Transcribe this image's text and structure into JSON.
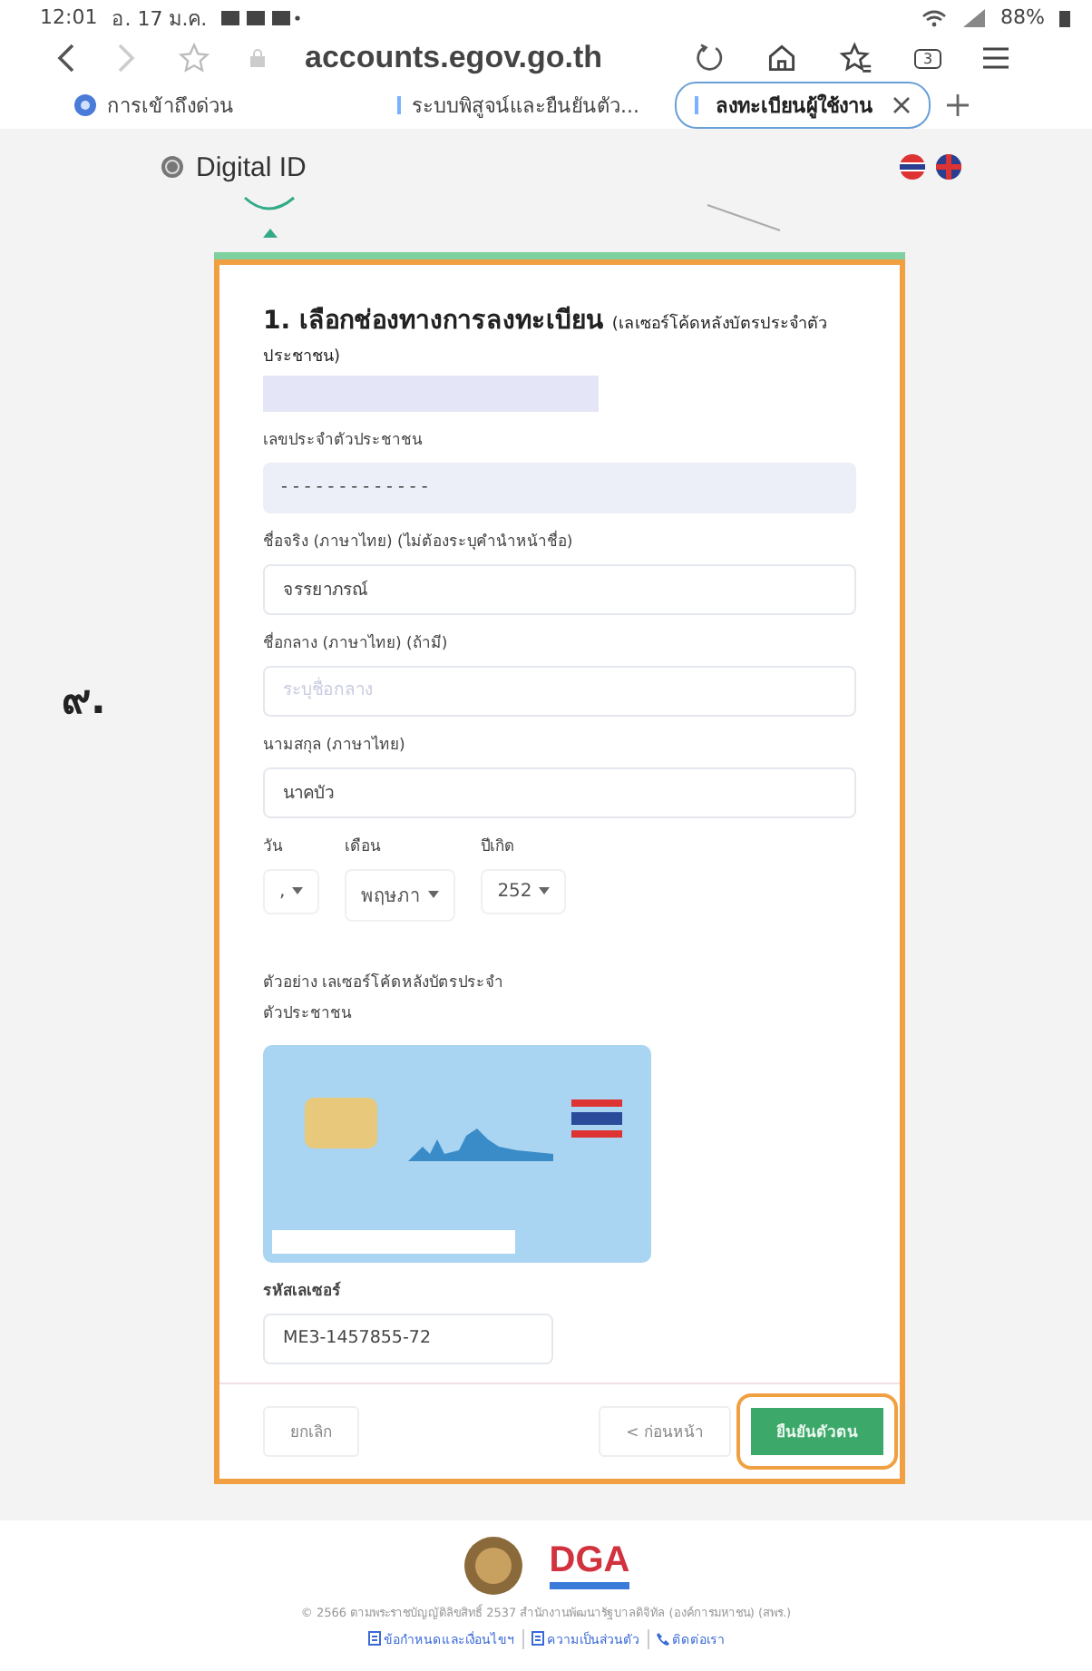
{
  "status_bar": {
    "time": "12:01",
    "date": "อ. 17 ม.ค.",
    "battery": "88%"
  },
  "browser": {
    "url": "accounts.egov.go.th",
    "tab_count": "3"
  },
  "tabs": [
    {
      "label": "การเข้าถึงด่วน",
      "selected": false,
      "kind": "shortcut"
    },
    {
      "label": "ระบบพิสูจน์และยืนยันตัว...",
      "selected": false,
      "kind": "page"
    },
    {
      "label": "ลงทะเบียนผู้ใช้งาน",
      "selected": true,
      "kind": "page"
    }
  ],
  "header": {
    "logo_text": "Digital ID"
  },
  "annotation": {
    "mark": "๙."
  },
  "form": {
    "title": "1. เลือกช่องทางการลงทะเบียน",
    "title_note": "(เลเซอร์โค้ดหลังบัตรประจำตัวประชาชน)",
    "fields": [
      {
        "label": "เลขประจำตัวประชาชน",
        "value": "- - - - - - - - - - - - -",
        "kind": "masked"
      },
      {
        "label": "ชื่อจริง (ภาษาไทย) (ไม่ต้องระบุคำนำหน้าชื่อ)",
        "value": "จรรยาภรณ์",
        "kind": "text"
      },
      {
        "label": "ชื่อกลาง (ภาษาไทย) (ถ้ามี)",
        "placeholder": "ระบุชื่อกลาง",
        "kind": "text"
      },
      {
        "label": "นามสกุล (ภาษาไทย)",
        "value": "นาคบัว",
        "kind": "text"
      }
    ],
    "birth": [
      {
        "label": "วัน",
        "value": ","
      },
      {
        "label": "เดือน",
        "value": "พฤษภา"
      },
      {
        "label": "ปีเกิด",
        "value": "252"
      }
    ],
    "example_caption": "ตัวอย่าง เลเซอร์โค้ดหลังบัตรประจำตัวประชาชน",
    "laser_label": "รหัสเลเซอร์",
    "laser_value": "ME3-1457855-72",
    "buttons": [
      {
        "label": "ยกเลิก",
        "kind": "cancel"
      },
      {
        "label": "< ก่อนหน้า",
        "kind": "back"
      },
      {
        "label": "ยืนยันตัวตน",
        "kind": "primary"
      }
    ]
  },
  "footer": {
    "logo_text": "DGA",
    "copyright": "© 2566 ตามพระราชบัญญัติลิขสิทธิ์ 2537 สำนักงานพัฒนารัฐบาลดิจิทัล (องค์การมหาชน) (สพร.)",
    "links": [
      {
        "label": "ข้อกำหนดและเงื่อนไขฯ",
        "kind": "doc"
      },
      {
        "label": "ความเป็นส่วนตัว",
        "kind": "doc"
      },
      {
        "label": "ติดต่อเรา",
        "kind": "phone"
      }
    ]
  }
}
